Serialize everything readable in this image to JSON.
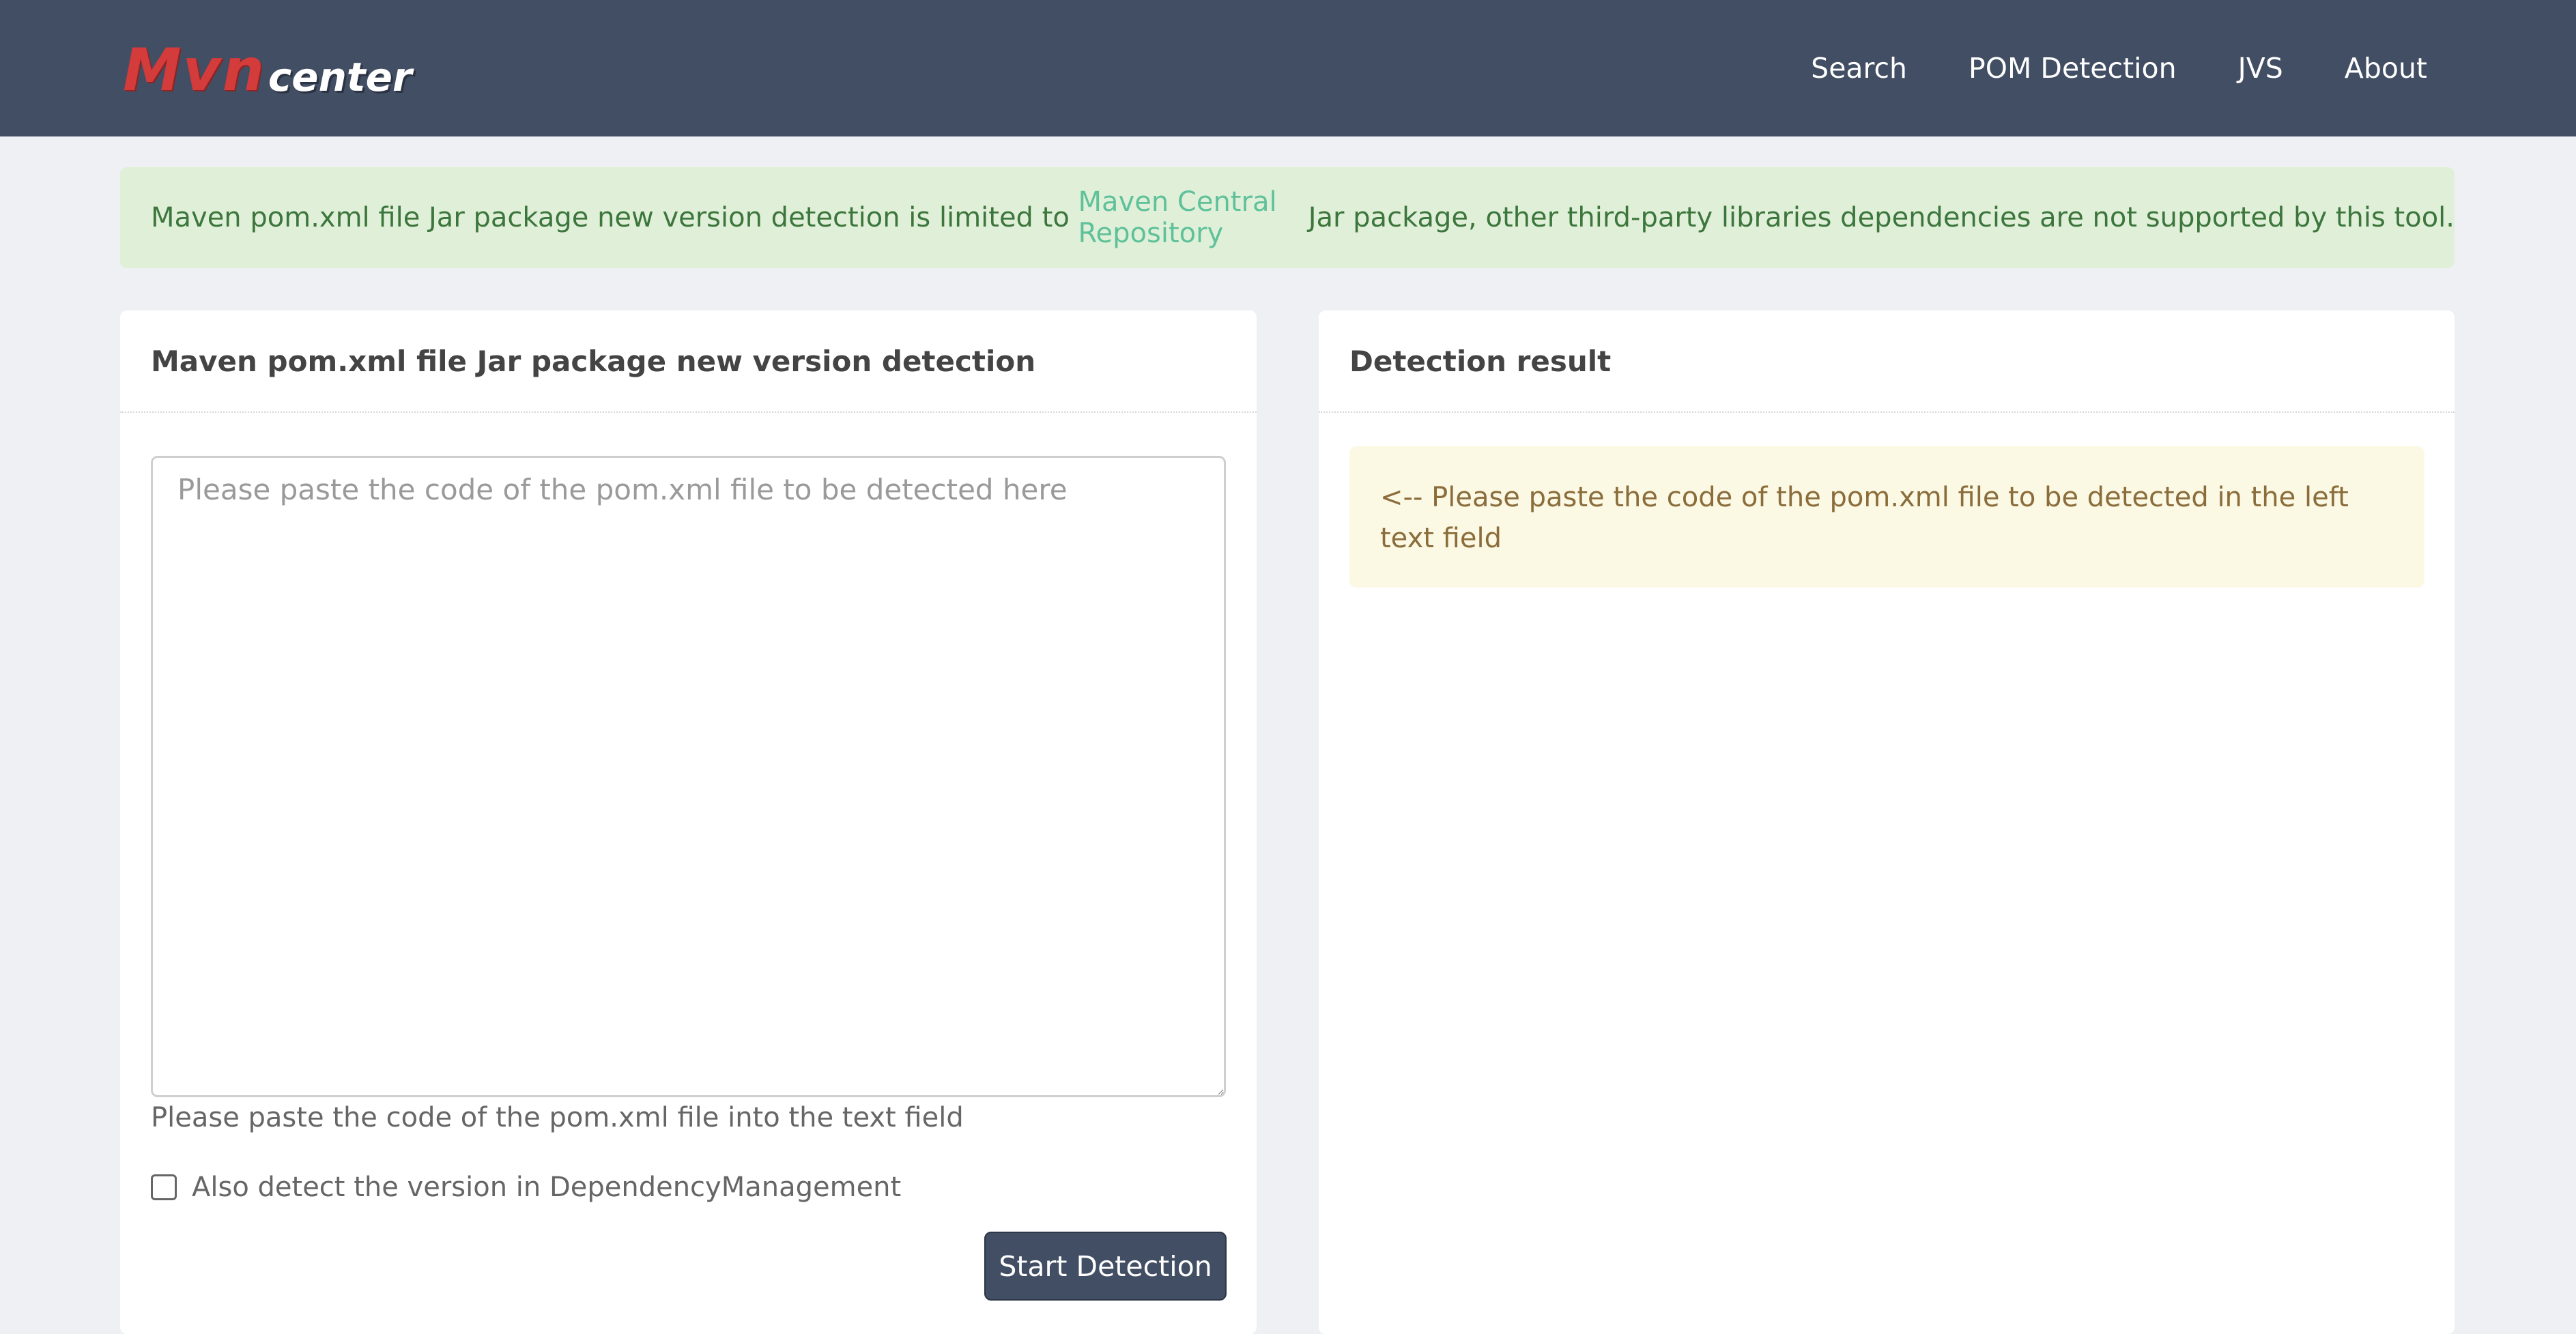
{
  "header": {
    "logo": {
      "part1": "Mvn",
      "part2": "center"
    },
    "nav": [
      "Search",
      "POM Detection",
      "JVS",
      "About"
    ]
  },
  "notice": {
    "before": "Maven pom.xml file Jar package new version detection is limited to ",
    "link": "Maven Central Repository",
    "after": " Jar package, other third-party libraries dependencies are not supported by this tool."
  },
  "left_panel": {
    "title": "Maven pom.xml file Jar package new version detection",
    "textarea_placeholder": "Please paste the code of the pom.xml file to be detected here",
    "help_text": "Please paste the code of the pom.xml file into the text field",
    "checkbox_label": "Also detect the version in DependencyManagement",
    "button_label": "Start Detection"
  },
  "right_panel": {
    "title": "Detection result",
    "message": "<-- Please paste the code of the pom.xml file to be detected in the left text field"
  },
  "colors": {
    "header_bg": "#424e63",
    "notice_bg": "#e0f0d8",
    "notice_text": "#3c763d",
    "notice_link": "#5fc19a",
    "result_bg": "#fbf8e3",
    "result_text": "#8a6d3b",
    "page_bg": "#eef0f4"
  }
}
